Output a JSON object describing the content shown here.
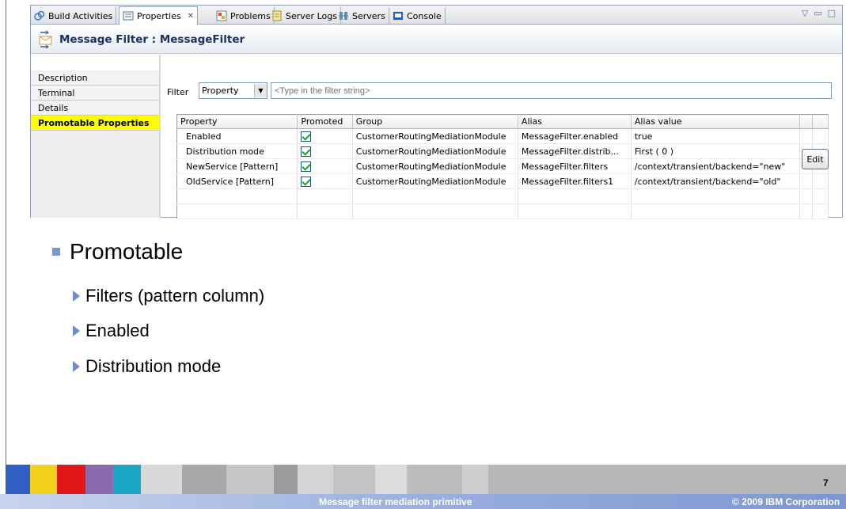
{
  "tabs": [
    {
      "label": "Build Activities",
      "icon": "build-activities-icon"
    },
    {
      "label": "Properties",
      "icon": "properties-icon",
      "close": "✕"
    },
    {
      "label": "Problems",
      "icon": "problems-icon"
    },
    {
      "label": "Server Logs",
      "icon": "server-logs-icon"
    },
    {
      "label": "Servers",
      "icon": "servers-icon"
    },
    {
      "label": "Console",
      "icon": "console-icon"
    }
  ],
  "view_menu": [
    "▽",
    "▭",
    "□"
  ],
  "editor": {
    "title": "Message Filter : MessageFilter",
    "icon": "message-filter-icon"
  },
  "sidebar": {
    "items": [
      {
        "label": "Description"
      },
      {
        "label": "Terminal"
      },
      {
        "label": "Details"
      },
      {
        "label": "Promotable Properties",
        "selected": true
      }
    ]
  },
  "filter": {
    "label": "Filter",
    "type_value": "Property",
    "placeholder": "<Type in the filter string>"
  },
  "table": {
    "headers": [
      "Property",
      "Promoted",
      "Group",
      "Alias",
      "Alias value"
    ],
    "rows": [
      {
        "property": "Enabled",
        "promoted": true,
        "group": "CustomerRoutingMediationModule",
        "alias": "MessageFilter.enabled",
        "alias_value": "true"
      },
      {
        "property": "Distribution mode",
        "promoted": true,
        "group": "CustomerRoutingMediationModule",
        "alias": "MessageFilter.distrib...",
        "alias_value": "First ( 0 )"
      },
      {
        "property": "NewService [Pattern]",
        "promoted": true,
        "group": "CustomerRoutingMediationModule",
        "alias": "MessageFilter.filters",
        "alias_value": "/context/transient/backend=\"new\""
      },
      {
        "property": "OldService [Pattern]",
        "promoted": true,
        "group": "CustomerRoutingMediationModule",
        "alias": "MessageFilter.filters1",
        "alias_value": "/context/transient/backend=\"old\""
      }
    ]
  },
  "edit_button": "Edit",
  "slide": {
    "heading": "Promotable",
    "bullets": [
      "Filters (pattern column)",
      "Enabled",
      "Distribution mode"
    ]
  },
  "footer": {
    "title": "Message filter mediation primitive",
    "copyright": "© 2009 IBM Corporation",
    "page": "7"
  },
  "colors": {
    "selection": "#ffff00",
    "bullet": "#7a96cf",
    "footer_bar": "#97acdc",
    "title_text": "#1b3160"
  }
}
